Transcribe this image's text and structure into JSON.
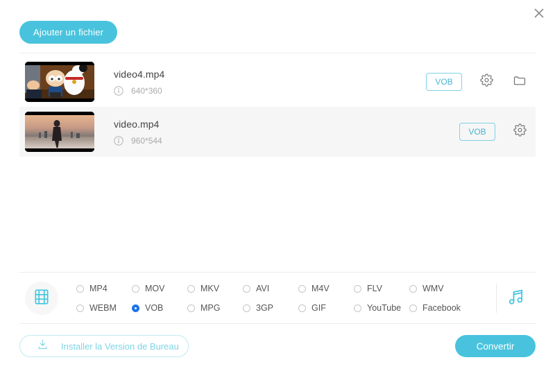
{
  "window": {
    "close_icon": "close-icon"
  },
  "toolbar": {
    "add_file_label": "Ajouter un fichier"
  },
  "files": {
    "items": [
      {
        "name": "video4.mp4",
        "dimensions": "640*360",
        "format_badge": "VOB",
        "settings_icon": "gear-icon",
        "folder_icon": "folder-icon",
        "info_icon": "info-icon",
        "thumbnail": "cartoon-video-thumbnail",
        "has_folder": true
      },
      {
        "name": "video.mp4",
        "dimensions": "960*544",
        "format_badge": "VOB",
        "settings_icon": "gear-icon",
        "info_icon": "info-icon",
        "thumbnail": "silhouette-video-thumbnail",
        "has_folder": false
      }
    ]
  },
  "format_panel": {
    "video_icon": "film-strip-icon",
    "audio_icon": "music-note-icon",
    "selected": "VOB",
    "options": [
      "MP4",
      "MOV",
      "MKV",
      "AVI",
      "M4V",
      "FLV",
      "WMV",
      "WEBM",
      "VOB",
      "MPG",
      "3GP",
      "GIF",
      "YouTube",
      "Facebook"
    ]
  },
  "footer": {
    "install_label": "Installer la Version de Bureau",
    "install_icon": "download-icon",
    "convert_label": "Convertir"
  },
  "colors": {
    "accent": "#49c3dd",
    "accent_border": "#7fd2e4",
    "radio_selected": "#1a73e8",
    "row_alt_bg": "#f6f6f6",
    "divider": "#ececec",
    "install_text": "#7fd4e6"
  }
}
